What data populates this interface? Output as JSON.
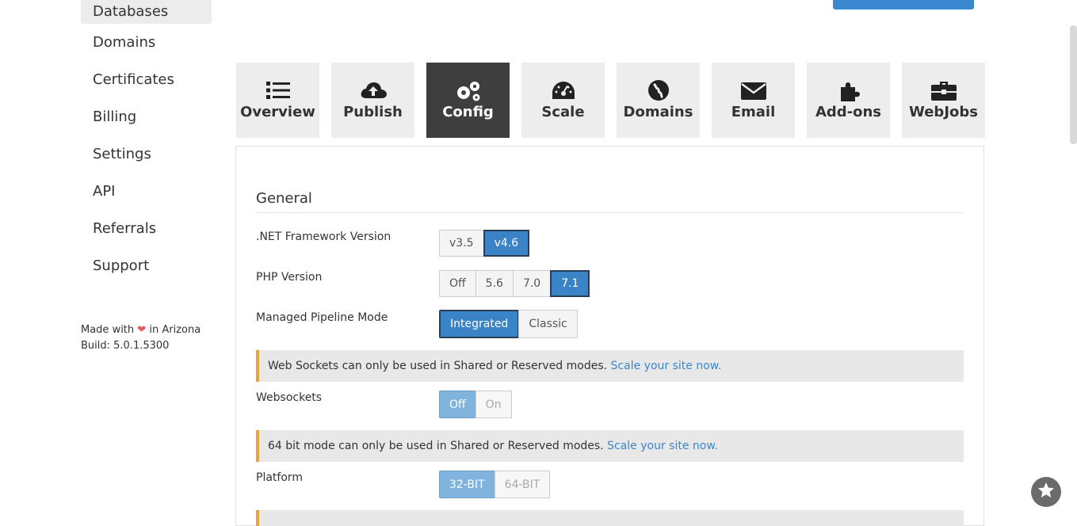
{
  "sidebar": {
    "items": [
      {
        "label": "Databases",
        "active": true
      },
      {
        "label": "Domains"
      },
      {
        "label": "Certificates"
      },
      {
        "label": "Billing"
      },
      {
        "label": "Settings"
      },
      {
        "label": "API"
      },
      {
        "label": "Referrals"
      },
      {
        "label": "Support"
      }
    ],
    "made_prefix": "Made with",
    "made_suffix": "in Arizona",
    "build": "Build: 5.0.1.5300"
  },
  "tabs": [
    {
      "label": "Overview",
      "icon": "list-icon"
    },
    {
      "label": "Publish",
      "icon": "cloud-upload-icon"
    },
    {
      "label": "Config",
      "icon": "gears-icon",
      "active": true
    },
    {
      "label": "Scale",
      "icon": "dashboard-icon"
    },
    {
      "label": "Domains",
      "icon": "globe-icon"
    },
    {
      "label": "Email",
      "icon": "envelope-icon"
    },
    {
      "label": "Add-ons",
      "icon": "puzzle-icon"
    },
    {
      "label": "WebJobs",
      "icon": "briefcase-icon"
    }
  ],
  "general": {
    "title": "General",
    "net": {
      "label": ".NET Framework Version",
      "options": [
        "v3.5",
        "v4.6"
      ],
      "selected": "v4.6"
    },
    "php": {
      "label": "PHP Version",
      "options": [
        "Off",
        "5.6",
        "7.0",
        "7.1"
      ],
      "selected": "7.1"
    },
    "pipeline": {
      "label": "Managed Pipeline Mode",
      "options": [
        "Integrated",
        "Classic"
      ],
      "selected": "Integrated"
    },
    "ws_notice": {
      "text": "Web Sockets can only be used in Shared or Reserved modes.",
      "link": "Scale your site now."
    },
    "websockets": {
      "label": "Websockets",
      "options": [
        "Off",
        "On"
      ],
      "selected": "Off"
    },
    "bit_notice": {
      "text": "64 bit mode can only be used in Shared or Reserved modes.",
      "link": "Scale your site now."
    },
    "platform": {
      "label": "Platform",
      "options": [
        "32-BIT",
        "64-BIT"
      ],
      "selected": "32-BIT"
    }
  },
  "colors": {
    "accent": "#3a83c7",
    "warning": "#e8a33d",
    "link": "#3a87cf"
  }
}
